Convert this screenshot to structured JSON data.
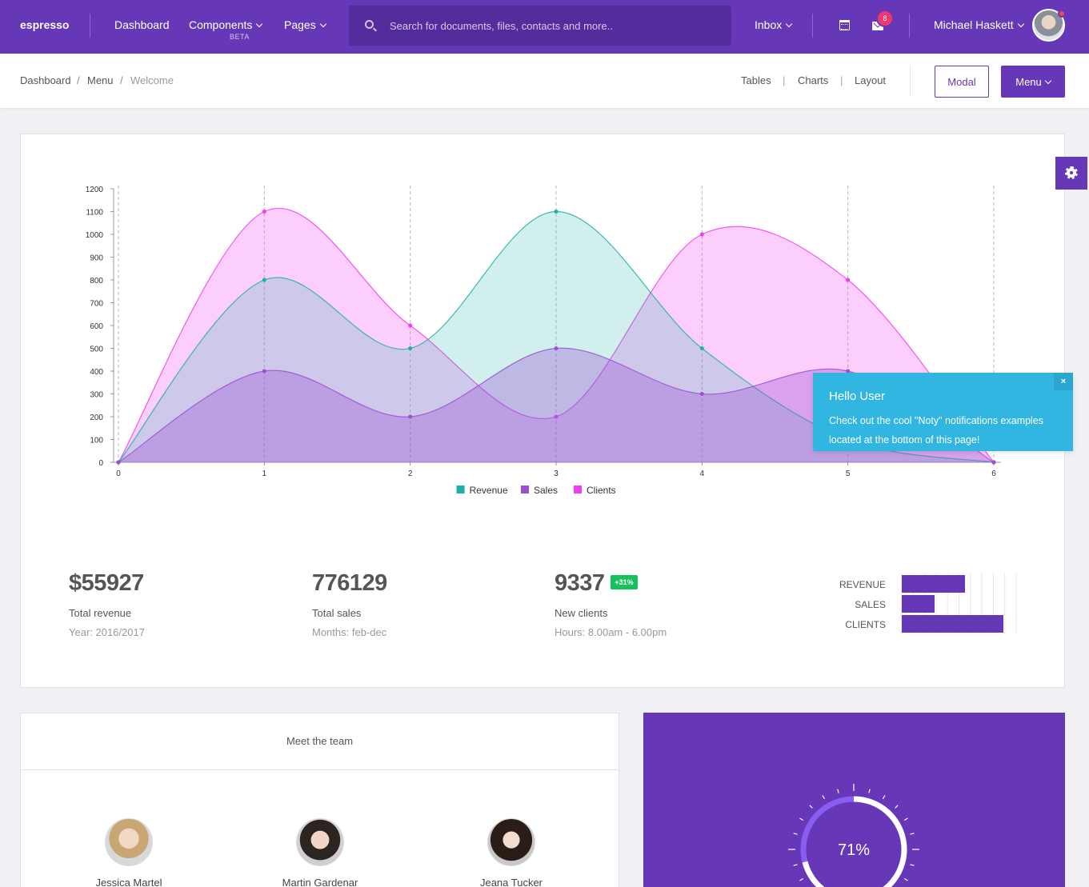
{
  "nav": {
    "brand": "espresso",
    "links": [
      {
        "label": "Dashboard",
        "has_caret": false
      },
      {
        "label": "Components",
        "has_caret": true,
        "sublabel": "BETA"
      },
      {
        "label": "Pages",
        "has_caret": true
      }
    ],
    "search_placeholder": "Search for documents, files, contacts and more..",
    "inbox_label": "Inbox",
    "mail_badge": "8",
    "user_name": "Michael Haskett",
    "icons": [
      "search-icon",
      "calendar-icon",
      "mail-icon"
    ]
  },
  "subheader": {
    "breadcrumb": [
      "Dashboard",
      "Menu",
      "Welcome"
    ],
    "links": [
      "Tables",
      "Charts",
      "Layout"
    ],
    "modal_button": "Modal",
    "menu_button": "Menu"
  },
  "chart_data": {
    "type": "area",
    "x": [
      0,
      1,
      2,
      3,
      4,
      5,
      6
    ],
    "ylim": [
      0,
      1200
    ],
    "yticks": [
      0,
      100,
      200,
      300,
      400,
      500,
      600,
      700,
      800,
      900,
      1000,
      1100,
      1200
    ],
    "series": [
      {
        "name": "Revenue",
        "color": "#1ab2a6",
        "values": [
          0,
          800,
          500,
          1100,
          500,
          100,
          0
        ]
      },
      {
        "name": "Sales",
        "color": "#9c4fd4",
        "values": [
          0,
          400,
          200,
          500,
          300,
          400,
          0
        ]
      },
      {
        "name": "Clients",
        "color": "#f23cf2",
        "values": [
          0,
          1100,
          600,
          200,
          1000,
          800,
          0
        ]
      }
    ],
    "legend_position": "bottom-center",
    "grid": "vertical-dashed"
  },
  "stats": [
    {
      "value": "$55927",
      "label": "Total revenue",
      "sub": "Year: 2016/2017"
    },
    {
      "value": "776129",
      "label": "Total sales",
      "sub": "Months: feb-dec"
    },
    {
      "value": "9337",
      "label": "New clients",
      "sub": "Hours: 8.00am - 6.00pm",
      "badge": "+31%"
    }
  ],
  "minibars": [
    {
      "label": "REVENUE",
      "fraction": 0.55
    },
    {
      "label": "SALES",
      "fraction": 0.29
    },
    {
      "label": "CLIENTS",
      "fraction": 0.89
    }
  ],
  "toast": {
    "title": "Hello User",
    "message": "Check out the cool \"Noty\" notifications examples located at the bottom of this page!",
    "close": "×"
  },
  "team": {
    "title": "Meet the team",
    "members": [
      "Jessica Martel",
      "Martin Gardenar",
      "Jeana Tucker"
    ]
  },
  "progress": {
    "value": 71,
    "label": "71%"
  },
  "colors": {
    "primary": "#6637b6",
    "toast": "#31b5e1",
    "badge_green": "#17c15c",
    "mail_badge": "#f0376f"
  }
}
